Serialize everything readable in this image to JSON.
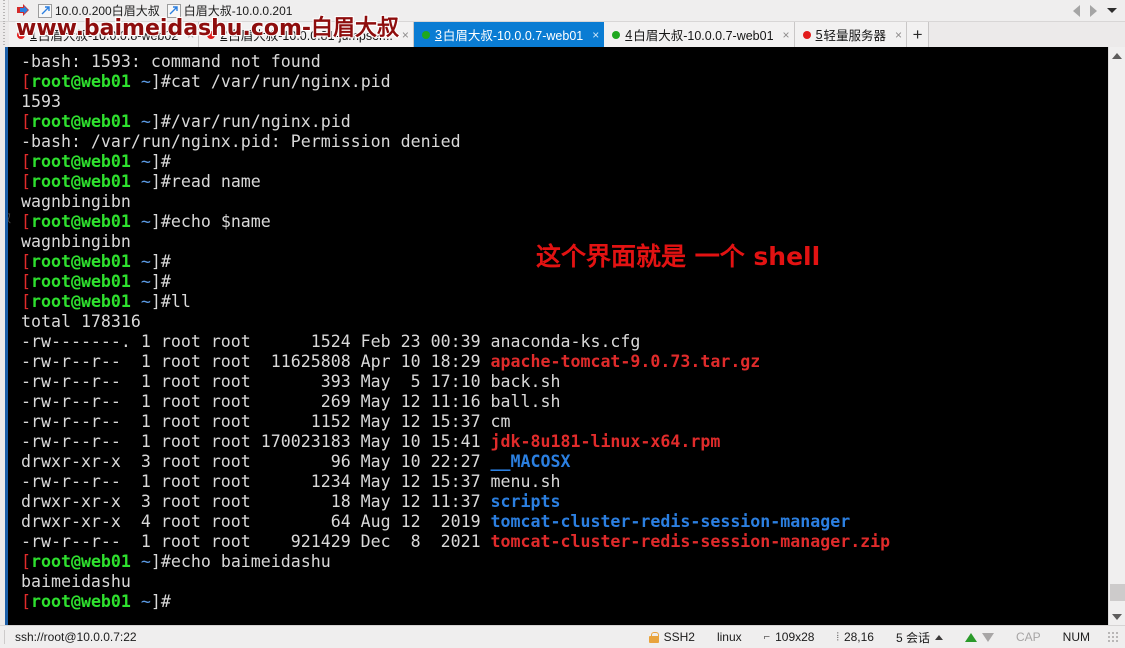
{
  "toolbar": {
    "arrow_icon": "arrow-right-icon",
    "sessions": [
      {
        "icon": "shortcut-icon",
        "label": "10.0.0.200白眉大叔"
      },
      {
        "icon": "shortcut-icon",
        "label": "白眉大叔-10.0.0.201"
      }
    ],
    "nav_prev": "nav-prev-icon",
    "nav_next": "nav-next-icon",
    "overflow": "chevron-down-icon"
  },
  "watermark_top": "www.baimeidashu.com-白眉大叔",
  "watermark_mid": "这个界面就是 一个 shell",
  "tabs": [
    {
      "num": "1",
      "label": "白眉大叔-10.0.0.8-web02",
      "dot": "red",
      "active": false,
      "close": "×"
    },
    {
      "num": "2",
      "label": "白眉大叔-10.0.0.81-jumpser...",
      "dot": "red",
      "active": false,
      "close": "×"
    },
    {
      "num": "3",
      "label": "白眉大叔-10.0.0.7-web01",
      "dot": "green",
      "active": true,
      "close": "×"
    },
    {
      "num": "4",
      "label": "白眉大叔-10.0.0.7-web01",
      "dot": "green",
      "active": false,
      "close": "×"
    },
    {
      "num": "5",
      "label": "轻量服务器",
      "dot": "red",
      "active": false,
      "close": "×"
    }
  ],
  "tab_new_label": "+",
  "terminal": {
    "prompt": {
      "open": "[",
      "user": "root@web01",
      "path": " ~",
      "close": "]#"
    },
    "lines": [
      {
        "type": "plain",
        "text": "-bash: 1593: command not found"
      },
      {
        "type": "prompt",
        "cmd": "cat /var/run/nginx.pid"
      },
      {
        "type": "plain",
        "text": "1593"
      },
      {
        "type": "prompt",
        "cmd": "/var/run/nginx.pid"
      },
      {
        "type": "plain",
        "text": "-bash: /var/run/nginx.pid: Permission denied"
      },
      {
        "type": "prompt",
        "cmd": ""
      },
      {
        "type": "prompt",
        "cmd": "read name"
      },
      {
        "type": "plain",
        "text": "wagnbingibn"
      },
      {
        "type": "prompt",
        "cmd": "echo $name"
      },
      {
        "type": "plain",
        "text": "wagnbingibn"
      },
      {
        "type": "prompt",
        "cmd": ""
      },
      {
        "type": "prompt",
        "cmd": ""
      },
      {
        "type": "prompt",
        "cmd": "ll"
      },
      {
        "type": "plain",
        "text": "total 178316"
      },
      {
        "type": "ls",
        "perms": "-rw-------.",
        "links": "1",
        "owner": "root",
        "group": "root",
        "size": "1524",
        "month": "Feb",
        "day": "23",
        "time": "00:39",
        "name": "anaconda-ks.cfg",
        "color": "plain"
      },
      {
        "type": "ls",
        "perms": "-rw-r--r--",
        "links": "1",
        "owner": "root",
        "group": "root",
        "size": "11625808",
        "month": "Apr",
        "day": "10",
        "time": "18:29",
        "name": "apache-tomcat-9.0.73.tar.gz",
        "color": "archive"
      },
      {
        "type": "ls",
        "perms": "-rw-r--r--",
        "links": "1",
        "owner": "root",
        "group": "root",
        "size": "393",
        "month": "May",
        "day": "5",
        "time": "17:10",
        "name": "back.sh",
        "color": "plain"
      },
      {
        "type": "ls",
        "perms": "-rw-r--r--",
        "links": "1",
        "owner": "root",
        "group": "root",
        "size": "269",
        "month": "May",
        "day": "12",
        "time": "11:16",
        "name": "ball.sh",
        "color": "plain"
      },
      {
        "type": "ls",
        "perms": "-rw-r--r--",
        "links": "1",
        "owner": "root",
        "group": "root",
        "size": "1152",
        "month": "May",
        "day": "12",
        "time": "15:37",
        "name": "cm",
        "color": "plain"
      },
      {
        "type": "ls",
        "perms": "-rw-r--r--",
        "links": "1",
        "owner": "root",
        "group": "root",
        "size": "170023183",
        "month": "May",
        "day": "10",
        "time": "15:41",
        "name": "jdk-8u181-linux-x64.rpm",
        "color": "archive"
      },
      {
        "type": "ls",
        "perms": "drwxr-xr-x",
        "links": "3",
        "owner": "root",
        "group": "root",
        "size": "96",
        "month": "May",
        "day": "10",
        "time": "22:27",
        "name": "__MACOSX",
        "color": "dir"
      },
      {
        "type": "ls",
        "perms": "-rw-r--r--",
        "links": "1",
        "owner": "root",
        "group": "root",
        "size": "1234",
        "month": "May",
        "day": "12",
        "time": "15:37",
        "name": "menu.sh",
        "color": "plain"
      },
      {
        "type": "ls",
        "perms": "drwxr-xr-x",
        "links": "3",
        "owner": "root",
        "group": "root",
        "size": "18",
        "month": "May",
        "day": "12",
        "time": "11:37",
        "name": "scripts",
        "color": "dir"
      },
      {
        "type": "ls",
        "perms": "drwxr-xr-x",
        "links": "4",
        "owner": "root",
        "group": "root",
        "size": "64",
        "month": "Aug",
        "day": "12",
        "time": "2019",
        "name": "tomcat-cluster-redis-session-manager",
        "color": "dir"
      },
      {
        "type": "ls",
        "perms": "-rw-r--r--",
        "links": "1",
        "owner": "root",
        "group": "root",
        "size": "921429",
        "month": "Dec",
        "day": "8",
        "time": "2021",
        "name": "tomcat-cluster-redis-session-manager.zip",
        "color": "archive"
      },
      {
        "type": "prompt",
        "cmd": "echo baimeidashu"
      },
      {
        "type": "plain",
        "text": "baimeidashu"
      },
      {
        "type": "prompt",
        "cmd": ""
      }
    ]
  },
  "statusbar": {
    "connection": "ssh://root@10.0.0.7:22",
    "protocol": "SSH2",
    "terminal_type": "linux",
    "size": "109x28",
    "cursor": "28,16",
    "sessions": "5 会话",
    "cap": "CAP",
    "num": "NUM"
  },
  "colors": {
    "accent": "#0a7cd3",
    "terminal_bg": "#000000",
    "prompt_user": "#2ee02e",
    "prompt_bracket": "#e02b2b",
    "dir": "#2b7fe0",
    "archive": "#e02b2b",
    "watermark_mid": "#e21212",
    "watermark_top": "#8e0d0d"
  }
}
